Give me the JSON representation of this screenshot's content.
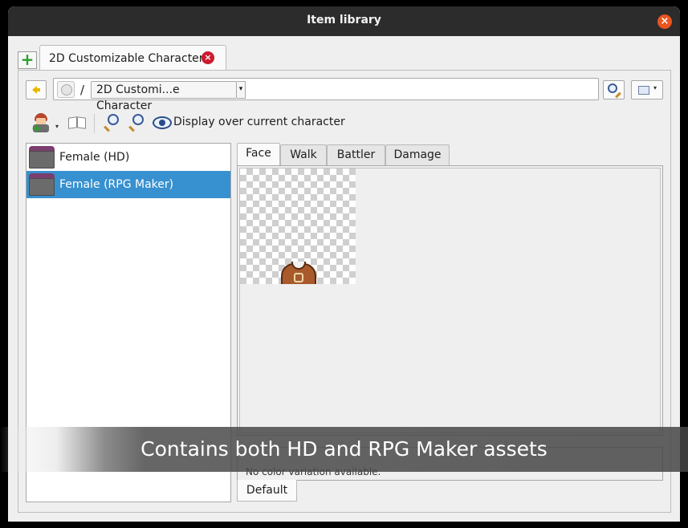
{
  "window": {
    "title": "Item library",
    "close_glyph": "×"
  },
  "doc_tabs": {
    "add_glyph": "+",
    "active": {
      "label": "2D Customizable Character",
      "close_glyph": "×"
    }
  },
  "path_bar": {
    "separator": "/",
    "crumb": "2D Customi...e Character",
    "crumb_dropdown_glyph": "▾"
  },
  "toolbar": {
    "dropdown_glyph": "▾",
    "plus_glyph": "+",
    "display_over_label": "Display over current character"
  },
  "folders": [
    {
      "label": "Female (HD)",
      "selected": false
    },
    {
      "label": "Female (RPG Maker)",
      "selected": true
    }
  ],
  "preview_tabs": [
    {
      "label": "Face",
      "active": true
    },
    {
      "label": "Walk",
      "active": false
    },
    {
      "label": "Battler",
      "active": false
    },
    {
      "label": "Damage",
      "active": false
    }
  ],
  "variations": {
    "message": "No color variation available.",
    "tab_label": "Default"
  },
  "caption": {
    "text": "Contains both HD and RPG Maker assets"
  },
  "icons": {
    "back": "arrow-left-icon",
    "home": "home-icon",
    "search": "magnifier-icon",
    "view": "view-mode-icon",
    "add_character": "add-character-icon",
    "book": "book-icon",
    "zoom_in": "zoom-in-icon",
    "zoom_out": "zoom-out-icon",
    "eye": "eye-icon",
    "folder": "folder-icon"
  },
  "colors": {
    "selection": "#3790cf",
    "close_red": "#cc1a2e",
    "titlebar": "#2c2c2c"
  }
}
